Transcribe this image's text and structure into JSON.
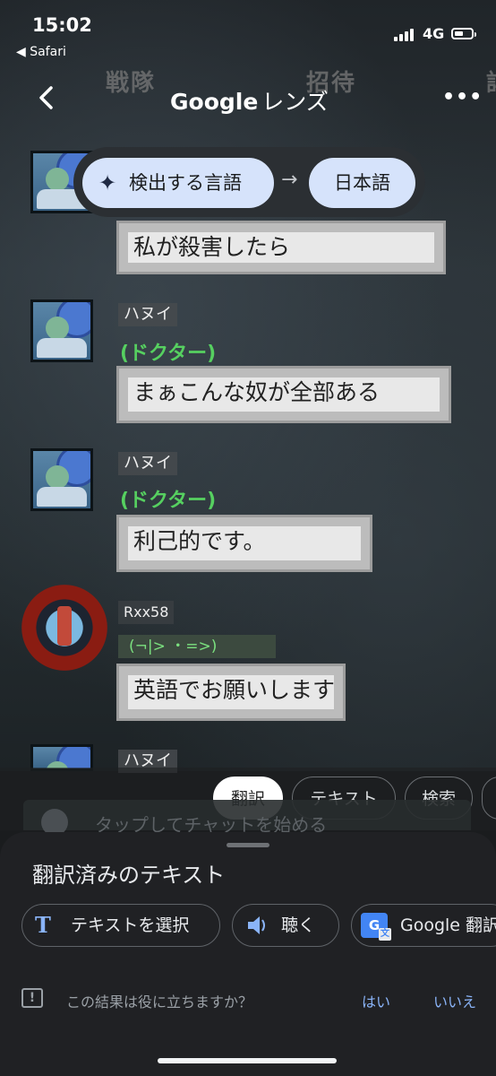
{
  "status_bar": {
    "time": "15:02",
    "back_app": "◀ Safari",
    "network": "4G"
  },
  "scene": {
    "tab_left": "戦隊",
    "tab_right": "招待",
    "tab_cut": "詳"
  },
  "header": {
    "title_brand": "Google",
    "title_suffix": "レンズ",
    "back_icon": "chevron-left-icon",
    "more_icon": "more-horizontal-icon"
  },
  "language_bar": {
    "source": "検出する言語",
    "target": "日本語",
    "arrow": "→"
  },
  "chat": {
    "messages": [
      {
        "text": "私が殺害したら"
      },
      {
        "name": "ハヌイ",
        "role": "(ドクター)",
        "text": "まぁこんな奴が全部ある"
      },
      {
        "name": "ハヌイ",
        "role": "(ドクター)",
        "text": "利己的です。"
      },
      {
        "name": "Rxx58",
        "role": "(¬|> ・=>)",
        "text": "英語でお願いします"
      },
      {
        "name": "ハヌイ"
      }
    ],
    "input_placeholder": "タップしてチャットを始める"
  },
  "mode_chips": [
    {
      "label": "翻訳",
      "active": true
    },
    {
      "label": "テキスト",
      "active": false
    },
    {
      "label": "検索",
      "active": false
    }
  ],
  "sheet": {
    "title": "翻訳済みのテキスト",
    "actions": [
      {
        "label": "テキストを選択",
        "icon": "text-select-icon"
      },
      {
        "label": "聴く",
        "icon": "speaker-icon"
      },
      {
        "label": "Google 翻訳",
        "icon": "google-translate-icon"
      }
    ],
    "feedback_question": "この結果は役に立ちますか？",
    "feedback_yes": "はい",
    "feedback_no": "いいえ"
  },
  "colors": {
    "chip_accent": "#d6e3fb",
    "link": "#8ab4f8",
    "role_green": "#56d060"
  }
}
